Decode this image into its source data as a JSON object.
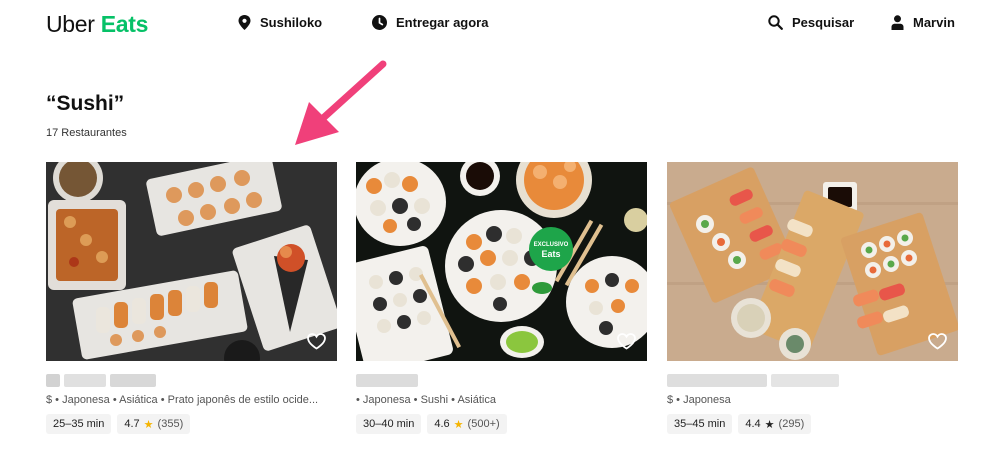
{
  "header": {
    "logo_part1": "Uber",
    "logo_part2": "Eats",
    "location": "Sushiloko",
    "delivery": "Entregar agora",
    "search": "Pesquisar",
    "user": "Marvin"
  },
  "search_result": {
    "title": "“Sushi”",
    "count": "17 Restaurantes"
  },
  "restaurants": [
    {
      "meta": "$ • Japonesa • Asiática • Prato japonês de estilo ocide...",
      "time": "25–35 min",
      "rating": "4.7",
      "reviews": "(355)"
    },
    {
      "meta": "• Japonesa • Sushi • Asiática",
      "time": "30–40 min",
      "rating": "4.6",
      "reviews": "(500+)",
      "badge_top": "EXCLUSIVO",
      "badge_bottom": "Eats"
    },
    {
      "meta": "$ • Japonesa",
      "time": "35–45 min",
      "rating": "4.4",
      "reviews": "(295)"
    }
  ],
  "colors": {
    "brand_green": "#06c167",
    "arrow_pink": "#f0407a",
    "star_gold": "#f5b400"
  }
}
